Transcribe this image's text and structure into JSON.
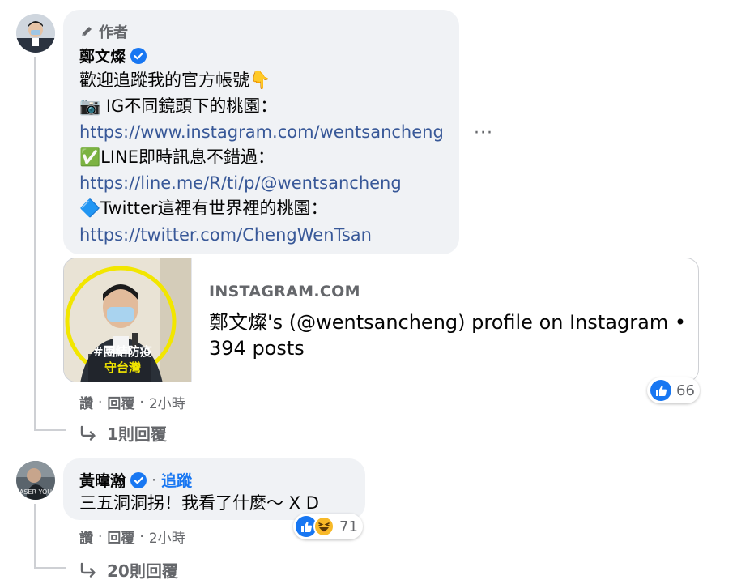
{
  "comment1": {
    "author_badge": "作者",
    "name": "鄭文燦",
    "lines": {
      "l1": "歡迎追蹤我的官方帳號👇",
      "l2": "📷 IG不同鏡頭下的桃園：",
      "l3": "https://www.instagram.com/wentsancheng",
      "l4": "✅LINE即時訊息不錯過：",
      "l5": "https://line.me/R/ti/p/@wentsancheng",
      "l6": "🔷Twitter這裡有世界裡的桃園：",
      "l7": "https://twitter.com/ChengWenTsan"
    },
    "more_label": "···",
    "link_preview": {
      "domain": "INSTAGRAM.COM",
      "title": "鄭文燦's (@wentsancheng) profile on Instagram • 394 posts",
      "thumb_text_1": "#團結防疫",
      "thumb_text_2": "守台灣"
    },
    "reactions": {
      "count": "66"
    },
    "actions": {
      "like": "讚",
      "reply": "回覆",
      "sep": "·",
      "time": "2小時"
    },
    "replies_label": "1則回覆"
  },
  "comment2": {
    "name": "黃暐瀚",
    "follow_label": "追蹤",
    "sep": "·",
    "text": "三五洞洞拐！我看了什麼～ X D",
    "avatar_text": "ASER YOU",
    "reactions": {
      "count": "71"
    },
    "actions": {
      "like": "讚",
      "reply": "回覆",
      "sep": "·",
      "time": "2小時"
    },
    "replies_label": "20則回覆"
  },
  "colors": {
    "bubble": "#f0f2f5",
    "link": "#385898",
    "accent": "#1877f2",
    "secondary_text": "#65676b"
  }
}
